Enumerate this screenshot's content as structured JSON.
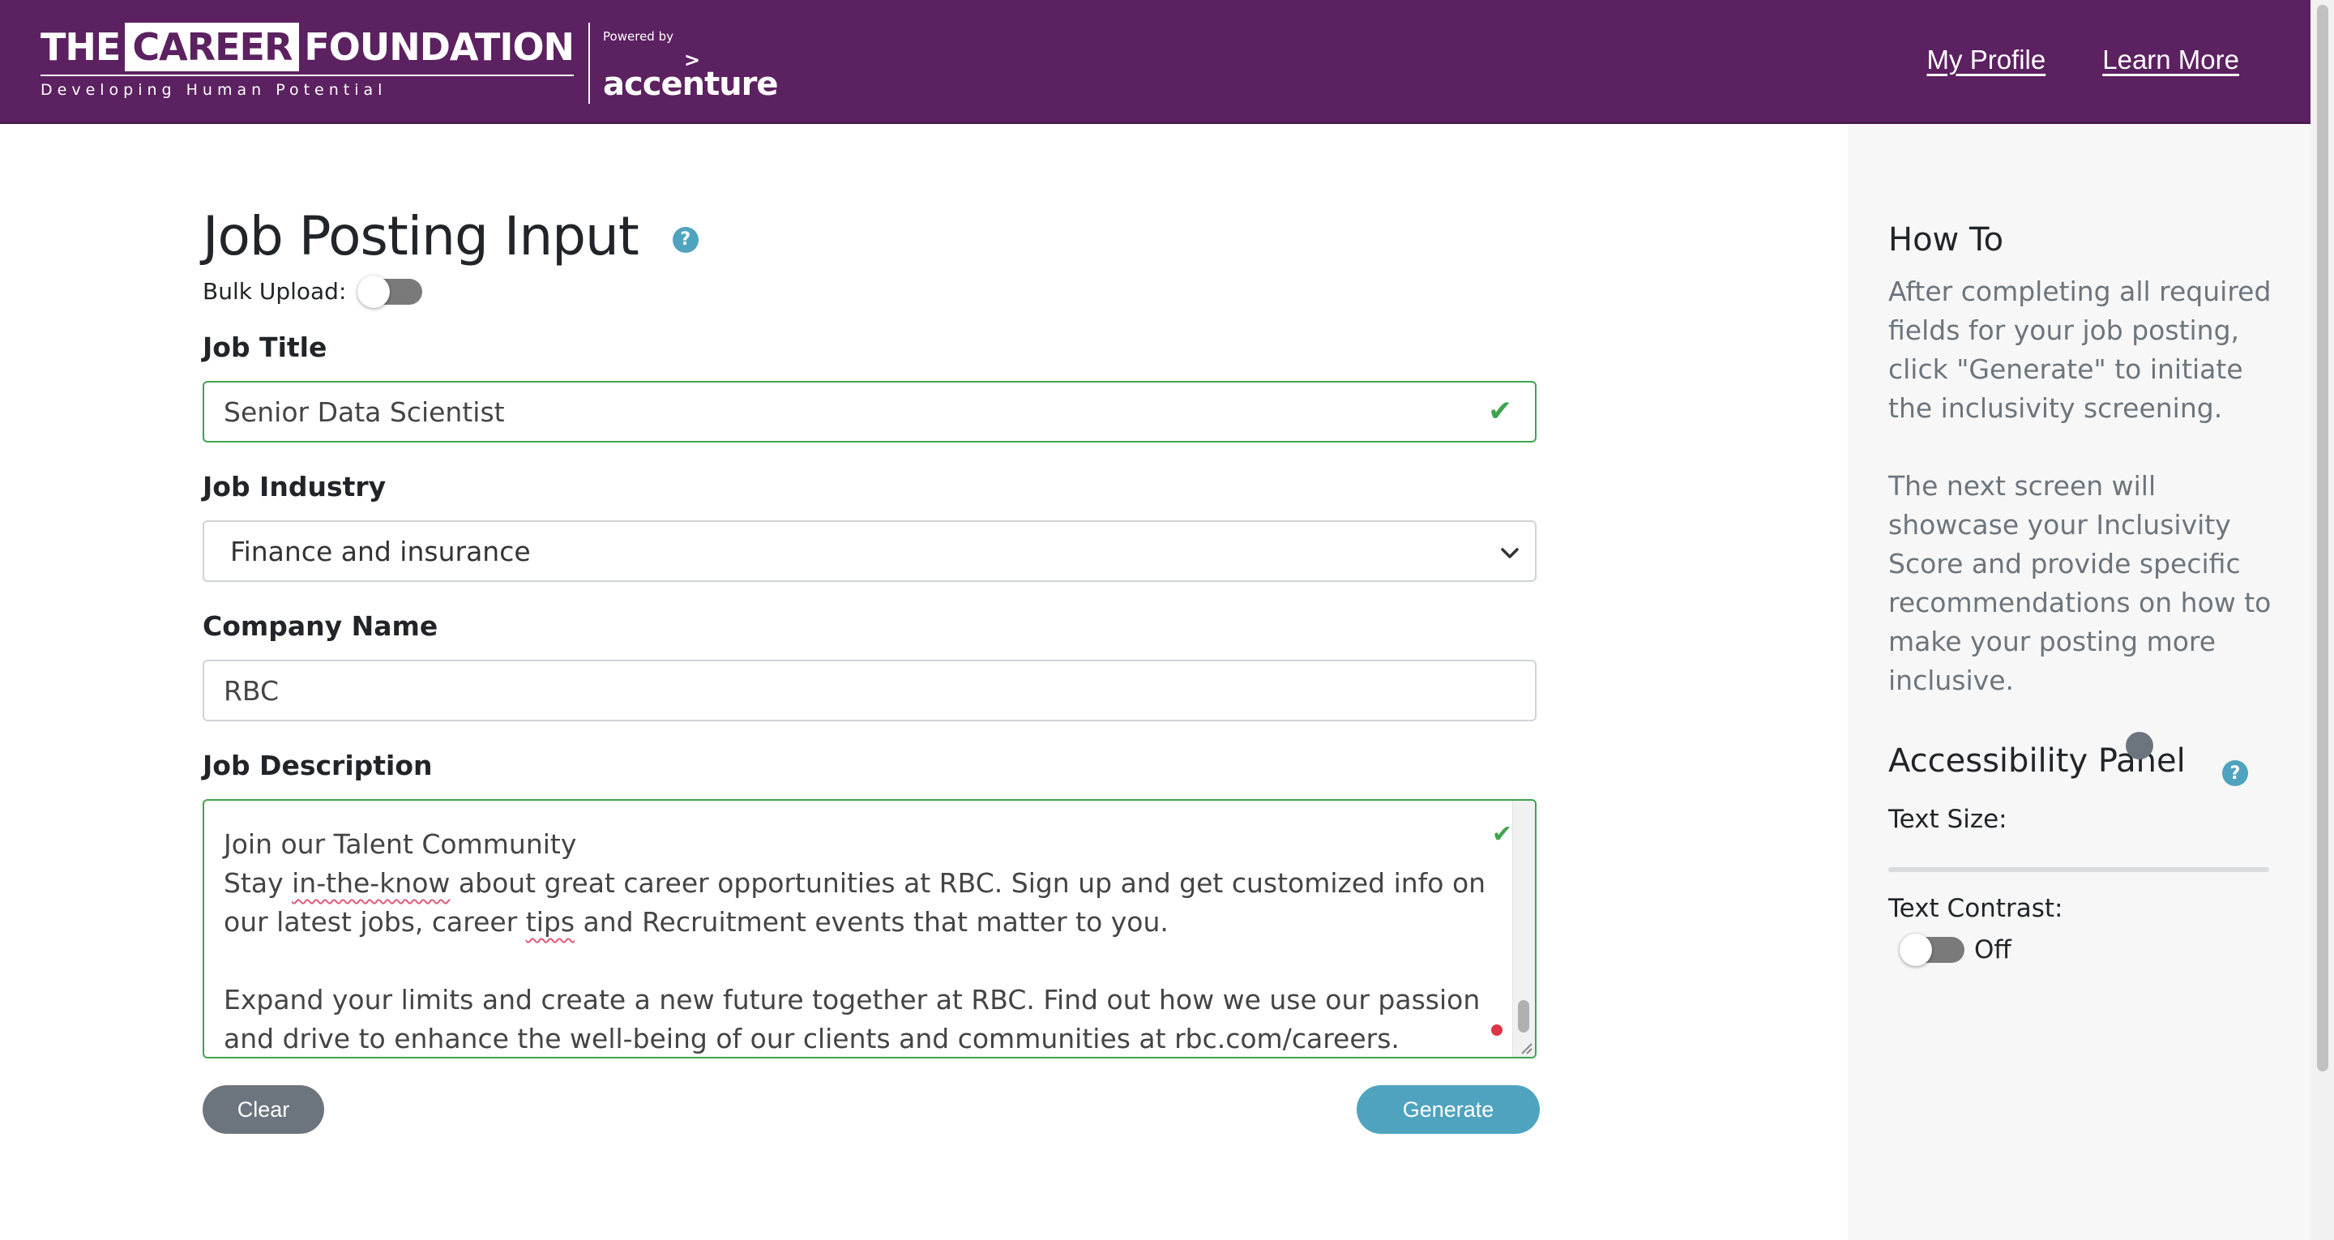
{
  "header": {
    "logo_word_1": "THE",
    "logo_word_2": "CAREER",
    "logo_word_3": "FOUNDATION",
    "logo_tagline": "Developing Human Potential",
    "powered_by": "Powered by",
    "powered_chevron": ">",
    "powered_brand": "accenture",
    "nav": {
      "profile": "My Profile",
      "learn_more": "Learn More"
    }
  },
  "form": {
    "title": "Job Posting Input",
    "help_glyph": "?",
    "bulk_upload_label": "Bulk Upload:",
    "bulk_upload_on": false,
    "job_title_label": "Job Title",
    "job_title_value": "Senior Data Scientist",
    "industry_label": "Job Industry",
    "industry_value": "Finance and insurance",
    "company_label": "Company Name",
    "company_value": "RBC",
    "description_label": "Job Description",
    "description": {
      "line1": "Join our Talent Community",
      "line2_a": "Stay ",
      "line2_spell": "in-the-know",
      "line2_b": " about great career opportunities at RBC. Sign up and get customized info on our latest jobs, career ",
      "line2_spell2": "tips",
      "line2_c": " and Recruitment events that matter to you.",
      "line3": "Expand your limits and create a new future together at RBC. Find out how we use our passion and drive to enhance the well-being of our clients and communities at rbc.com/careers."
    },
    "clear_label": "Clear",
    "generate_label": "Generate",
    "valid_color": "#3fa34d"
  },
  "side": {
    "howto_title": "How To",
    "howto_p1": "After completing all required fields for your job posting, click \"Generate\" to initiate the inclusivity screening.",
    "howto_p2": "The next screen will showcase your Inclusivity Score and provide specific recommendations on how to make your posting more inclusive.",
    "a11y_title": "Accessibility Panel",
    "text_size_label": "Text Size:",
    "text_size_level": 0.66,
    "text_contrast_label": "Text Contrast:",
    "text_contrast_state": "Off"
  },
  "colors": {
    "header_bg": "#5c2160",
    "accent": "#4fa3bf",
    "secondary": "#6c757d"
  }
}
